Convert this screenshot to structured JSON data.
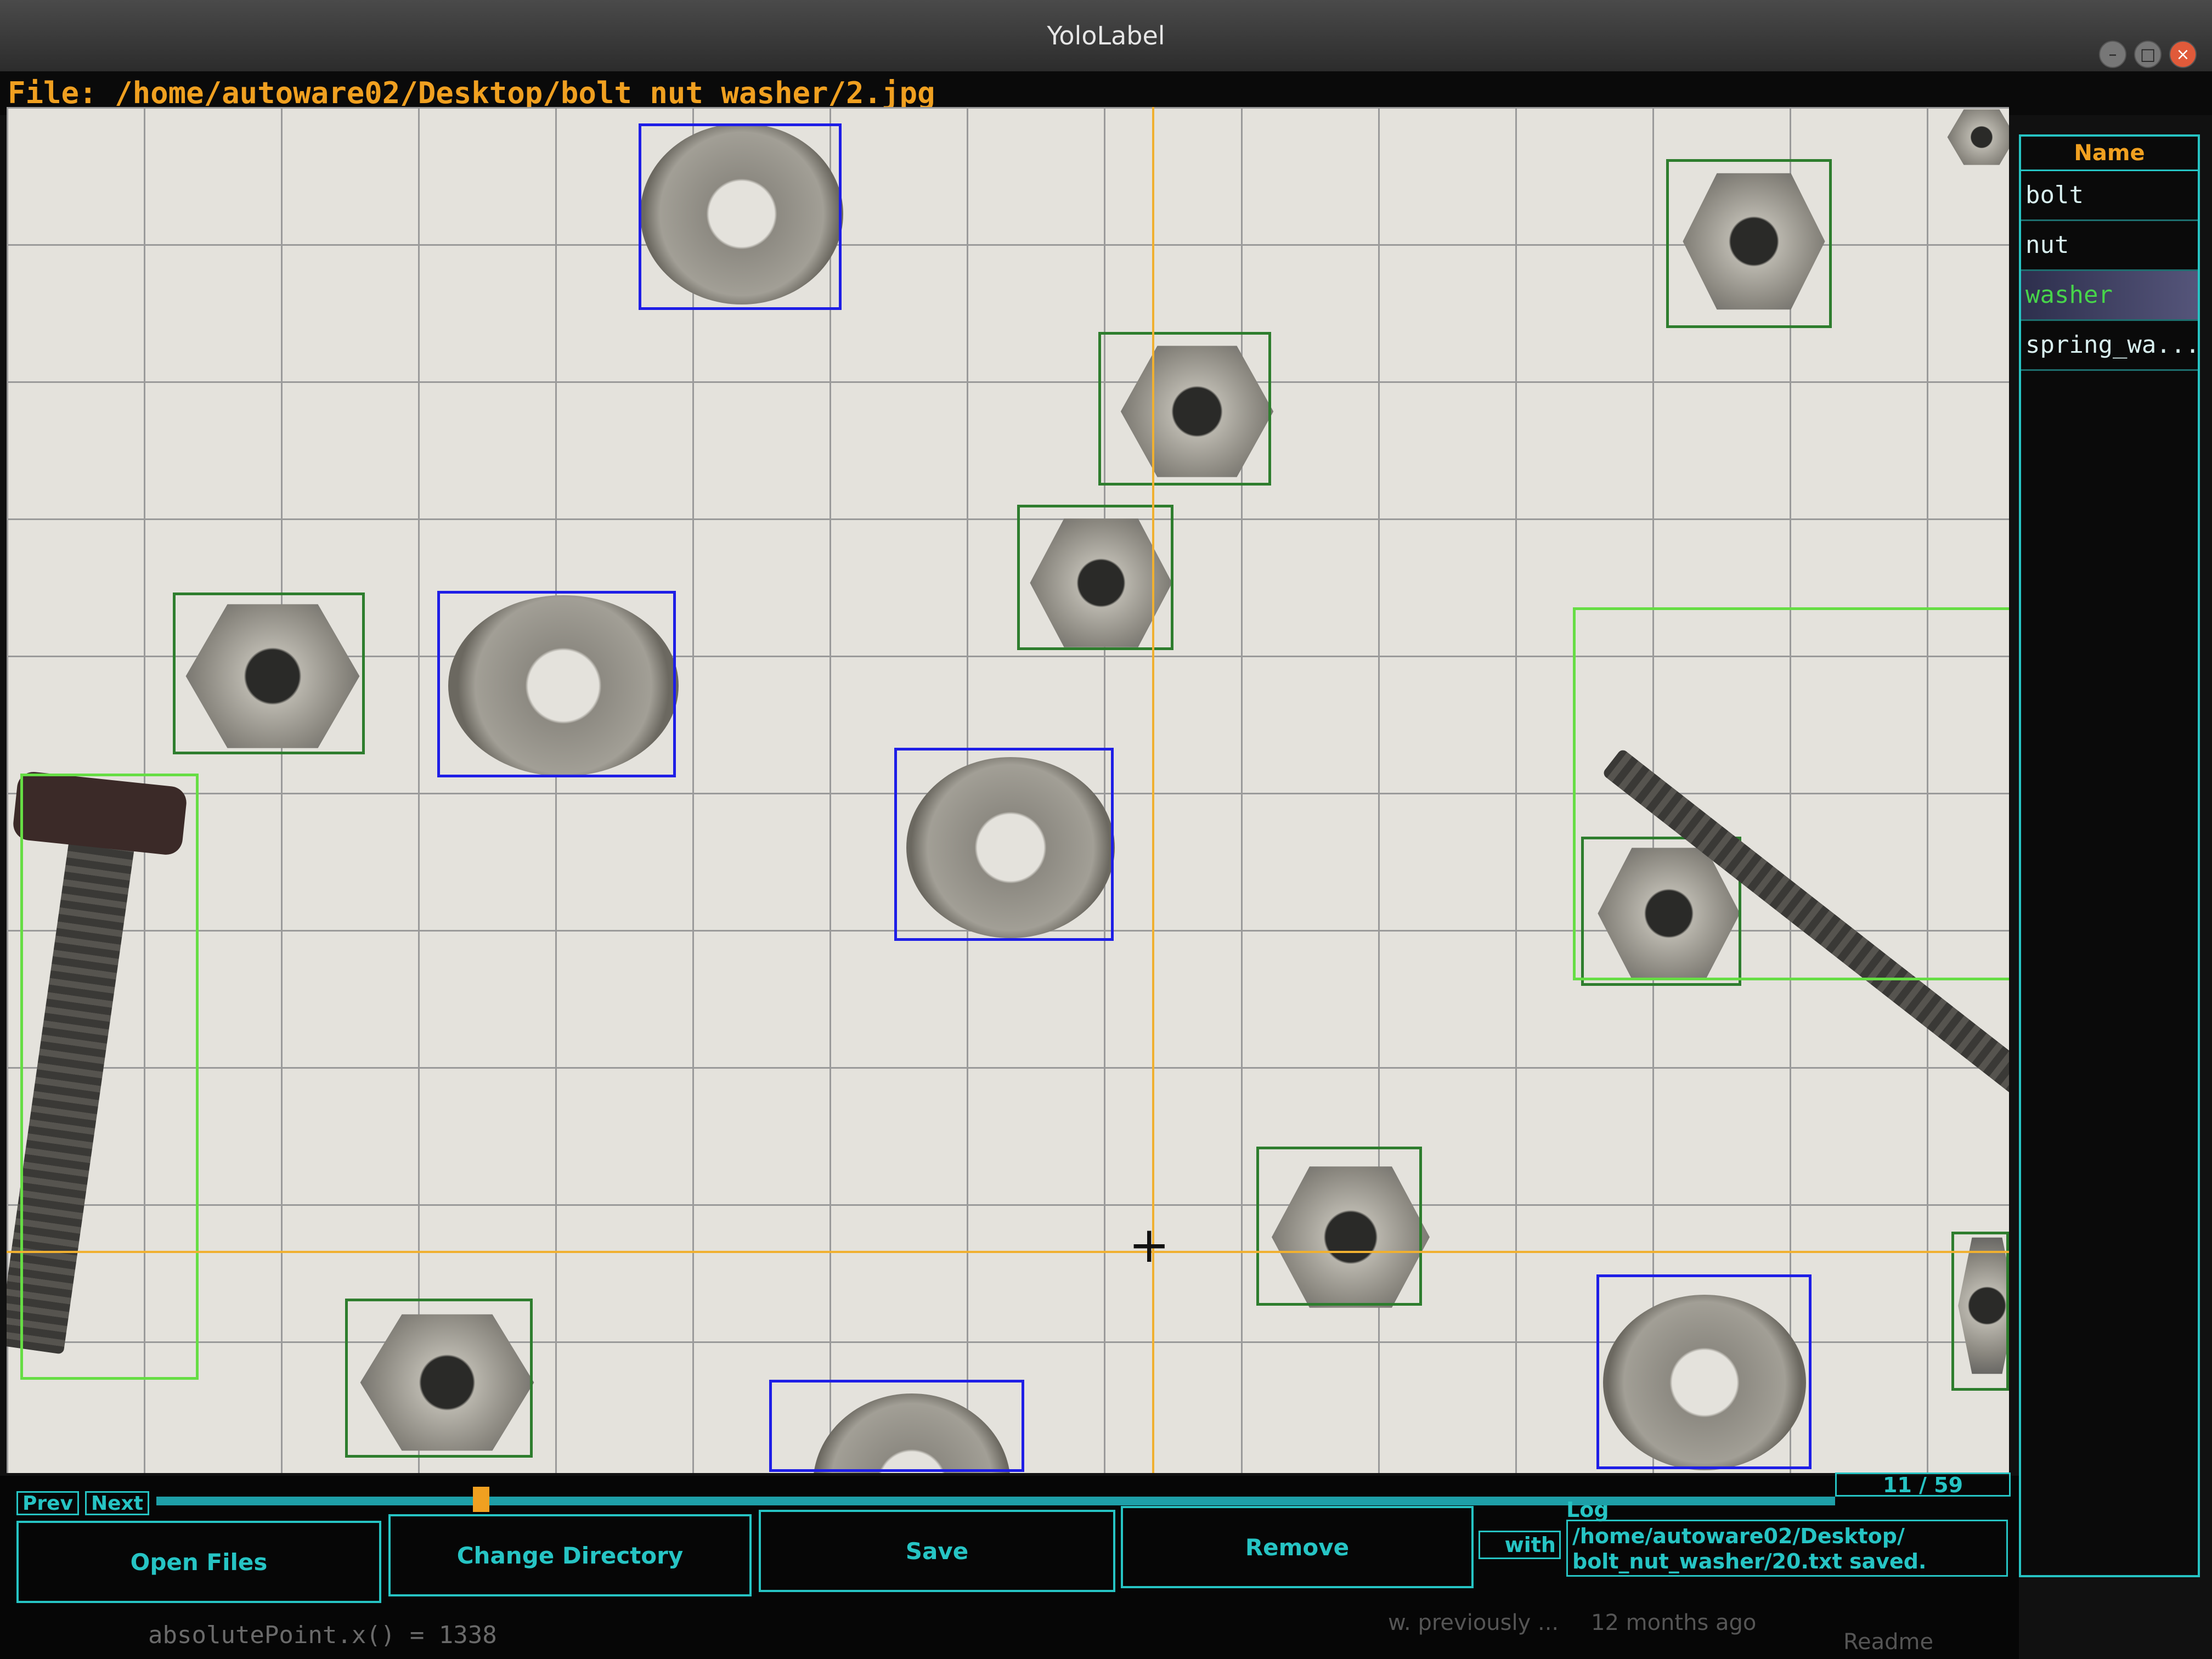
{
  "window": {
    "title": "YoloLabel"
  },
  "file": {
    "path": "File: /home/autoware02/Desktop/bolt_nut_washer/2.jpg"
  },
  "labels_panel": {
    "header": "Name",
    "items": [
      {
        "label": "bolt",
        "color": "#2e7d2e"
      },
      {
        "label": "nut",
        "color": "#2e7d2e"
      },
      {
        "label": "washer",
        "color": "#1e1ee6"
      },
      {
        "label": "spring_wa..."
      }
    ],
    "selected": "washer"
  },
  "navigation": {
    "prev": "Prev",
    "next": "Next",
    "counter": "11 / 59",
    "progress": 0.17
  },
  "buttons": {
    "open_files": "Open Files",
    "change_directory": "Change Directory",
    "save": "Save",
    "remove": "Remove"
  },
  "log": {
    "label": "Log",
    "message_line1": "/home/autoware02/Desktop/",
    "message_line2": "bolt_nut_washer/20.txt saved."
  },
  "partial_text": {
    "with": "with",
    "code": "absolutePoint.x() = 1338",
    "commit": "w. previously ...",
    "time": "12 months ago",
    "readme": "Readme"
  },
  "annotations": [
    {
      "class": "washer",
      "color": "#1e1ee6"
    },
    {
      "class": "nut",
      "color": "#2e7d2e"
    },
    {
      "class": "bolt",
      "color": "#66dd44"
    }
  ]
}
